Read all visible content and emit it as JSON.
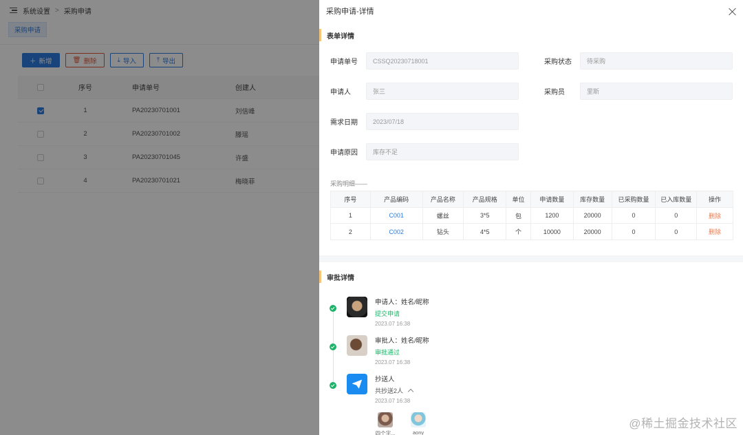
{
  "background": {
    "breadcrumb": [
      "系统设置",
      "采购申请"
    ],
    "tab": "采购申请",
    "toolbar": {
      "add": "新增",
      "delete": "删除",
      "import": "导入",
      "export": "导出"
    },
    "table": {
      "headers": [
        "序号",
        "申请单号",
        "创建人"
      ],
      "rows": [
        {
          "index": "1",
          "no": "PA20230701001",
          "creator": "刘信峰",
          "checked": true
        },
        {
          "index": "2",
          "no": "PA20230701002",
          "creator": "滕瑶",
          "checked": false
        },
        {
          "index": "3",
          "no": "PA20230701045",
          "creator": "许盛",
          "checked": false
        },
        {
          "index": "4",
          "no": "PA20230701021",
          "creator": "梅晓菲",
          "checked": false
        }
      ]
    }
  },
  "drawer": {
    "title": "采购申请-详情",
    "form_section": "表单详情",
    "fields": {
      "apply_no": {
        "label": "申请单号",
        "value": "CSSQ20230718001"
      },
      "purchase_status": {
        "label": "采购状态",
        "value": "待采购"
      },
      "applicant": {
        "label": "申请人",
        "value": "张三"
      },
      "buyer": {
        "label": "采购员",
        "value": "里斯"
      },
      "demand_date": {
        "label": "需求日期",
        "value": "2023/07/18"
      },
      "reason": {
        "label": "申请原因",
        "value": "库存不足"
      }
    },
    "detail_caption": "采购明细——",
    "detail_table": {
      "headers": [
        "序号",
        "产品编码",
        "产品名称",
        "产品规格",
        "单位",
        "申请数量",
        "库存数量",
        "已采购数量",
        "已入库数量",
        "操作"
      ],
      "rows": [
        {
          "idx": "1",
          "code": "C001",
          "name": "螺丝",
          "spec": "3*5",
          "unit": "包",
          "qty": "1200",
          "stock": "20000",
          "purchased": "0",
          "stored": "0",
          "op": "删除"
        },
        {
          "idx": "2",
          "code": "C002",
          "name": "钻头",
          "spec": "4*5",
          "unit": "个",
          "qty": "10000",
          "stock": "20000",
          "purchased": "0",
          "stored": "0",
          "op": "删除"
        }
      ]
    },
    "approval_section": "审批详情",
    "timeline": [
      {
        "name": "申请人：姓名/昵称",
        "status": "提交申请",
        "time": "2023.07 16:38",
        "avatar": "photo"
      },
      {
        "name": "审批人：姓名/昵称",
        "status": "审批通过",
        "time": "2023.07 16:38",
        "avatar": "photo"
      },
      {
        "name": "抄送人",
        "sub": "共抄送2人",
        "time": "2023.07 16:38",
        "avatar": "send-icon",
        "cc": [
          {
            "name": "四个字..."
          },
          {
            "name": "aony"
          }
        ]
      }
    ]
  },
  "watermark": "@稀土掘金技术社区"
}
